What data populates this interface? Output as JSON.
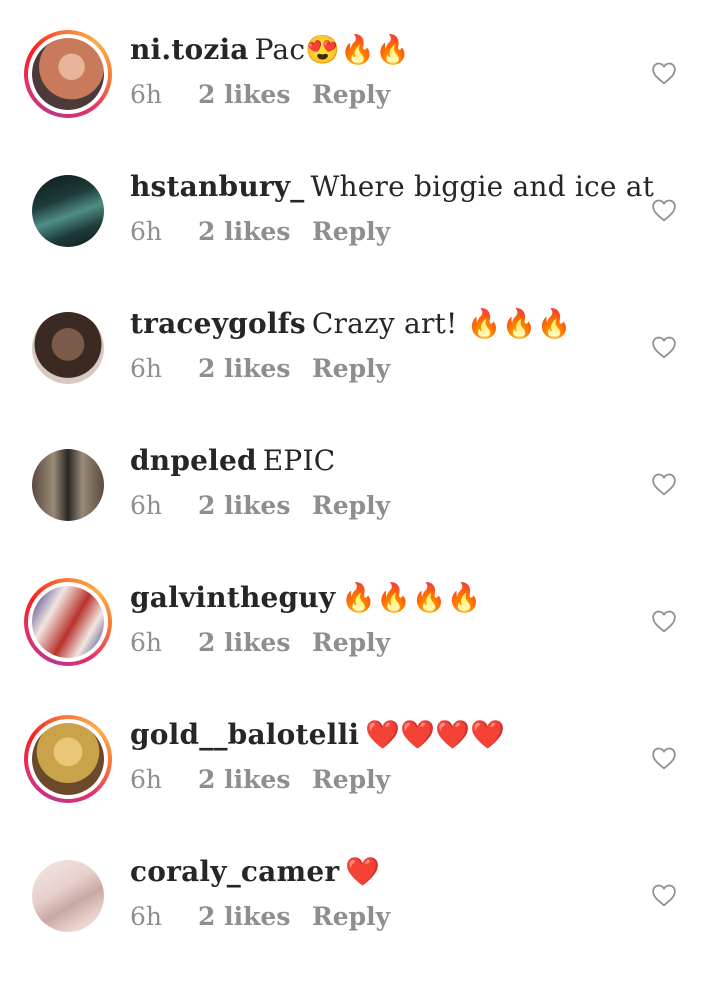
{
  "comments": [
    {
      "username": "ni.tozia",
      "text": "Pac😍🔥🔥",
      "time": "6h",
      "likes": "2 likes",
      "reply": "Reply",
      "story_ring": true,
      "avatar_colors": [
        "#c97a5a",
        "#4a3a3a",
        "#e8b49c"
      ]
    },
    {
      "username": "hstanbury_",
      "text": "Where biggie and ice at",
      "time": "6h",
      "likes": "2 likes",
      "reply": "Reply",
      "story_ring": false,
      "avatar_colors": [
        "#1e3b3a",
        "#4f8d86",
        "#0d1a1c"
      ]
    },
    {
      "username": "traceygolfs",
      "text": "Crazy art! 🔥🔥🔥",
      "time": "6h",
      "likes": "2 likes",
      "reply": "Reply",
      "story_ring": false,
      "avatar_colors": [
        "#3a2a22",
        "#7a5a48",
        "#d8c9c2"
      ]
    },
    {
      "username": "dnpeled",
      "text": "EPIC",
      "time": "6h",
      "likes": "2 likes",
      "reply": "Reply",
      "story_ring": false,
      "avatar_colors": [
        "#5a4a40",
        "#2a2624",
        "#9a8a78"
      ]
    },
    {
      "username": "galvintheguy",
      "text": "🔥🔥🔥🔥",
      "time": "6h",
      "likes": "2 likes",
      "reply": "Reply",
      "story_ring": true,
      "avatar_colors": [
        "#b8322e",
        "#f2e6e0",
        "#2a2a7a"
      ]
    },
    {
      "username": "gold__balotelli",
      "text": "❤️❤️❤️❤️",
      "time": "6h",
      "likes": "2 likes",
      "reply": "Reply",
      "story_ring": true,
      "avatar_colors": [
        "#c9a24a",
        "#6a4a2a",
        "#e8c878"
      ]
    },
    {
      "username": "coraly_camer",
      "text": "❤️",
      "time": "6h",
      "likes": "2 likes",
      "reply": "Reply",
      "story_ring": false,
      "avatar_colors": [
        "#e8d0cc",
        "#c8a8a4",
        "#f4e8e6"
      ]
    }
  ],
  "colors": {
    "text": "#262626",
    "muted": "#8e8e8e",
    "heart_outline": "#8e8e8e"
  },
  "icons": {
    "like": "heart-outline-icon"
  }
}
